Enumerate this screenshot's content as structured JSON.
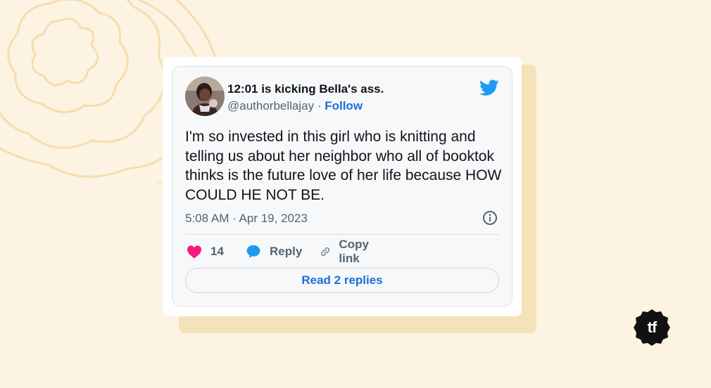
{
  "tweet": {
    "display_name": "12:01 is kicking Bella's ass.",
    "handle": "@authorbellajay",
    "separator": " · ",
    "follow_label": "Follow",
    "text": "I'm so invested in this girl who is knitting and telling us about her neighbor who all of booktok thinks is the future love of her life because HOW COULD HE NOT BE.",
    "timestamp": "5:08 AM · Apr 19, 2023",
    "likes_count": "14",
    "reply_label": "Reply",
    "copy_link_label": "Copy link",
    "read_replies_label": "Read 2 replies"
  },
  "brand_badge": {
    "text": "tf"
  },
  "colors": {
    "background": "#fdf3e2",
    "accent_blue": "#1d6fd6",
    "twitter_blue": "#1d9bf0",
    "like_pink": "#f91880",
    "decor_lines": "#f5ddb0",
    "shadow_card": "#f4e2b8"
  },
  "icons": [
    "twitter-bird-icon",
    "info-icon",
    "heart-icon",
    "reply-bubble-icon",
    "link-icon",
    "tf-logo-badge"
  ]
}
